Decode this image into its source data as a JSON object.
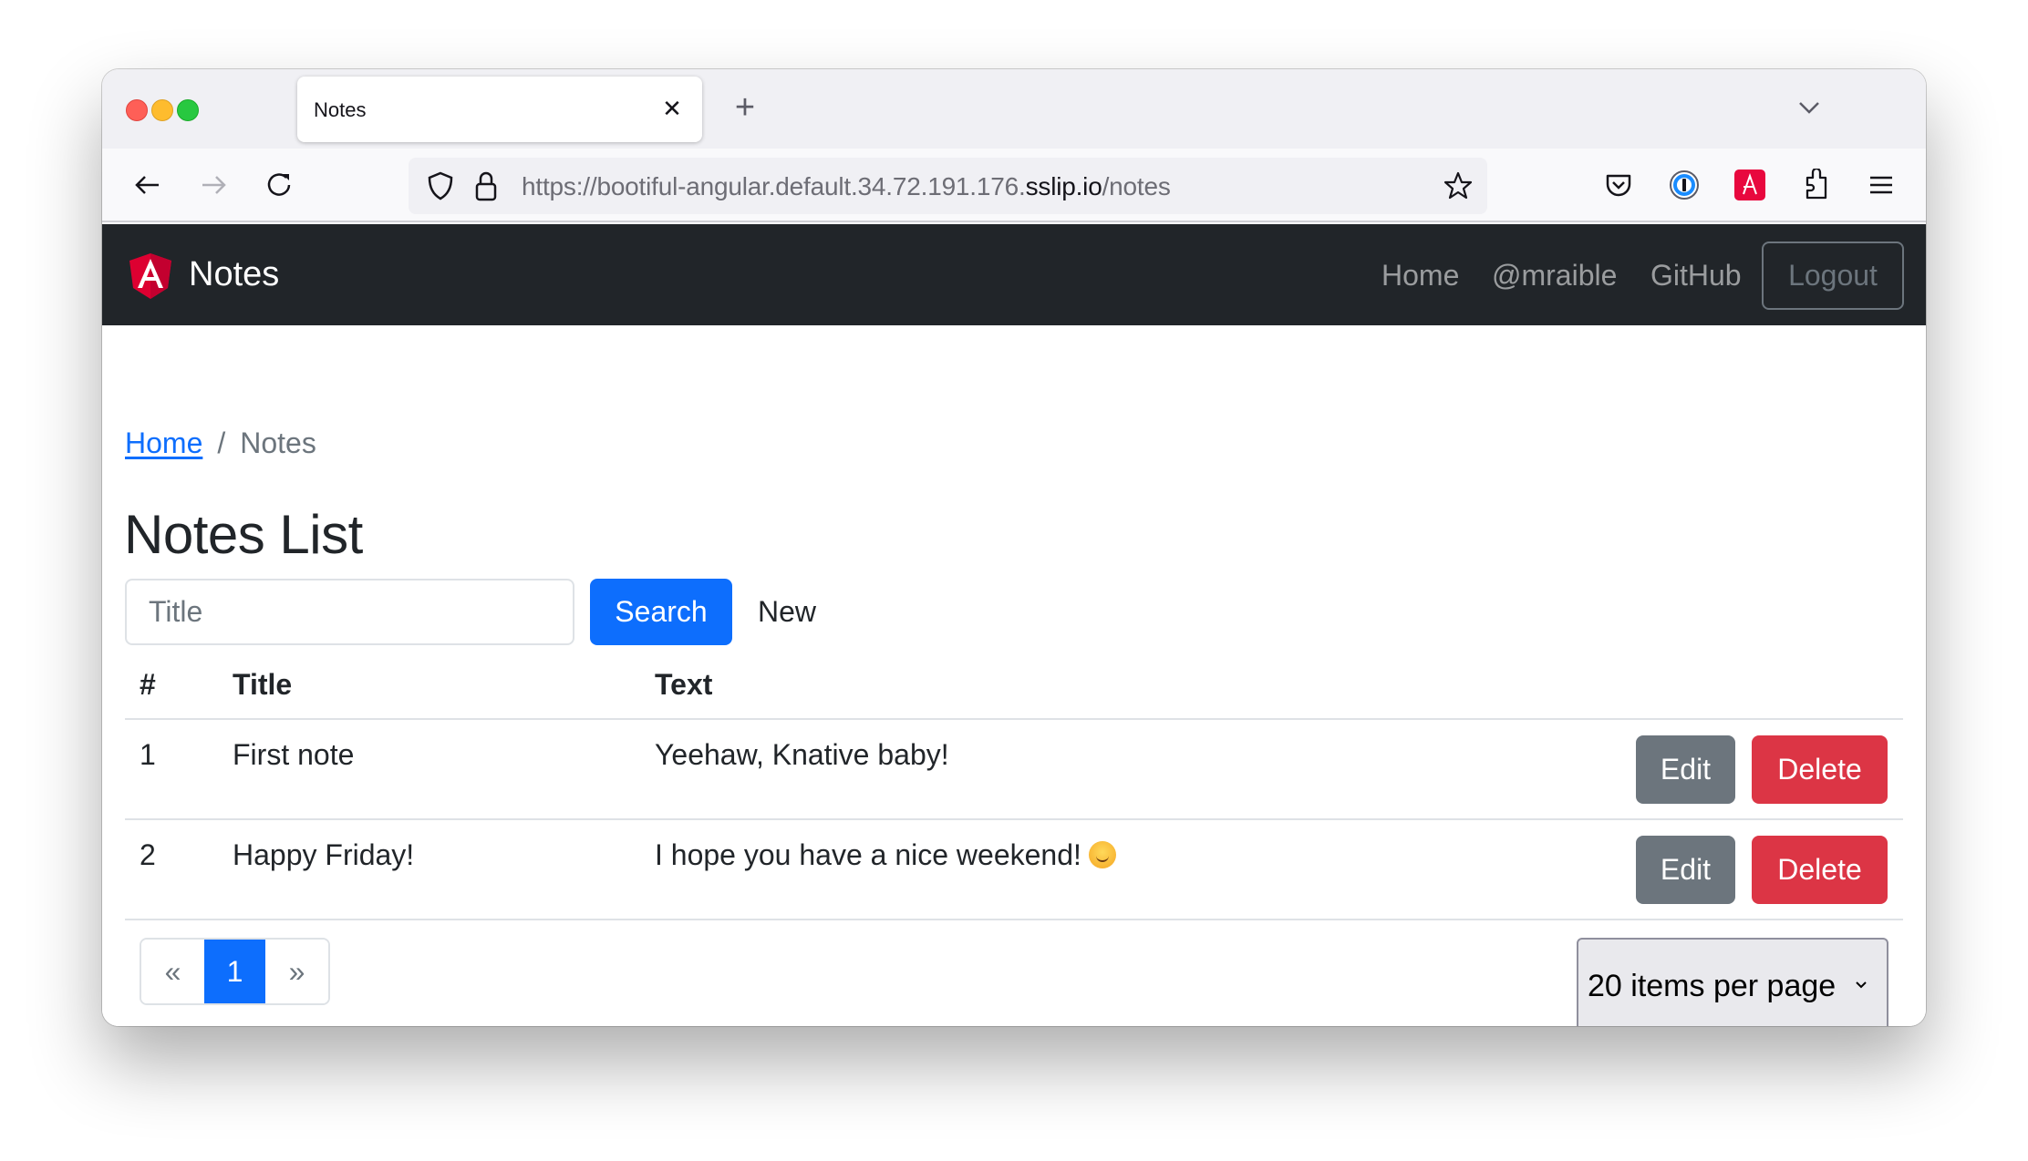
{
  "browser": {
    "tab_title": "Notes",
    "tab_close": "✕",
    "new_tab": "+",
    "url_prefix": "https://bootiful-angular.default.34.72.191.176.",
    "url_domain": "sslip.io",
    "url_suffix": "/notes"
  },
  "navbar": {
    "brand": "Notes",
    "links": [
      "Home",
      "@mraible",
      "GitHub"
    ],
    "logout": "Logout"
  },
  "breadcrumb": {
    "home": "Home",
    "separator": "/",
    "current": "Notes"
  },
  "page": {
    "title": "Notes List",
    "search_placeholder": "Title",
    "search_value": "",
    "search_button": "Search",
    "new_link": "New"
  },
  "table": {
    "headers": [
      "#",
      "Title",
      "Text"
    ],
    "rows": [
      {
        "id": "1",
        "title": "First note",
        "text": "Yeehaw, Knative baby!",
        "emoji": "",
        "edit": "Edit",
        "delete": "Delete"
      },
      {
        "id": "2",
        "title": "Happy Friday!",
        "text": "I hope you have a nice weekend!",
        "emoji": "smiling-face",
        "edit": "Edit",
        "delete": "Delete"
      }
    ]
  },
  "pagination": {
    "prev": "«",
    "current": "1",
    "next": "»"
  },
  "page_size": {
    "selected": "20 items per page"
  },
  "colors": {
    "primary": "#0d6efd",
    "secondary": "#6c757d",
    "danger": "#dc3545",
    "navbar": "#212529"
  }
}
